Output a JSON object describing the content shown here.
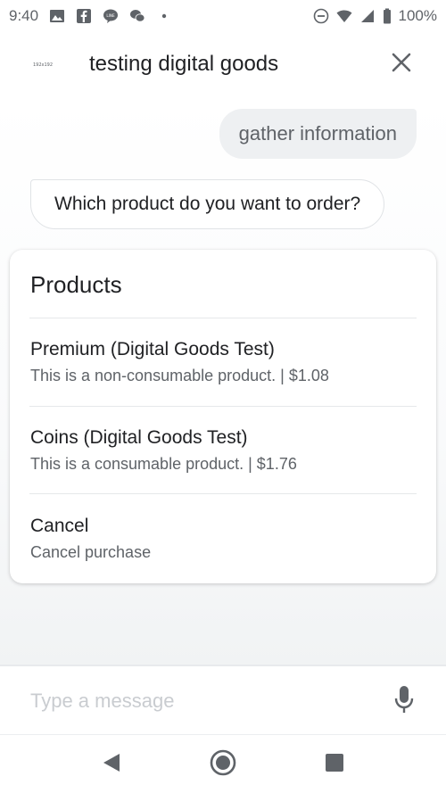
{
  "status_bar": {
    "time": "9:40",
    "battery": "100%",
    "icons": [
      "gallery-icon",
      "facebook-icon",
      "line-icon",
      "wechat-icon",
      "notification-dot-icon",
      "do-not-disturb-icon",
      "wifi-icon",
      "signal-icon",
      "battery-icon"
    ]
  },
  "app_bar": {
    "logo_text": "192x192",
    "title": "testing digital goods",
    "close_icon": "close-icon"
  },
  "chat": {
    "user_message": "gather information",
    "bot_message": "Which product do you want to order?"
  },
  "products_card": {
    "title": "Products",
    "items": [
      {
        "title": "Premium (Digital Goods Test)",
        "description": "This is a non-consumable product. | $1.08"
      },
      {
        "title": "Coins (Digital Goods Test)",
        "description": "This is a consumable product. | $1.76"
      },
      {
        "title": "Cancel",
        "description": "Cancel purchase"
      }
    ]
  },
  "input": {
    "placeholder": "Type a message",
    "value": "",
    "mic_icon": "microphone-icon"
  },
  "nav": {
    "icons": [
      "back-icon",
      "home-icon",
      "recents-icon"
    ]
  },
  "colors": {
    "text_primary": "#202124",
    "text_secondary": "#5f6368",
    "user_bubble_bg": "#eef0f2",
    "placeholder": "#c9ccd0"
  }
}
